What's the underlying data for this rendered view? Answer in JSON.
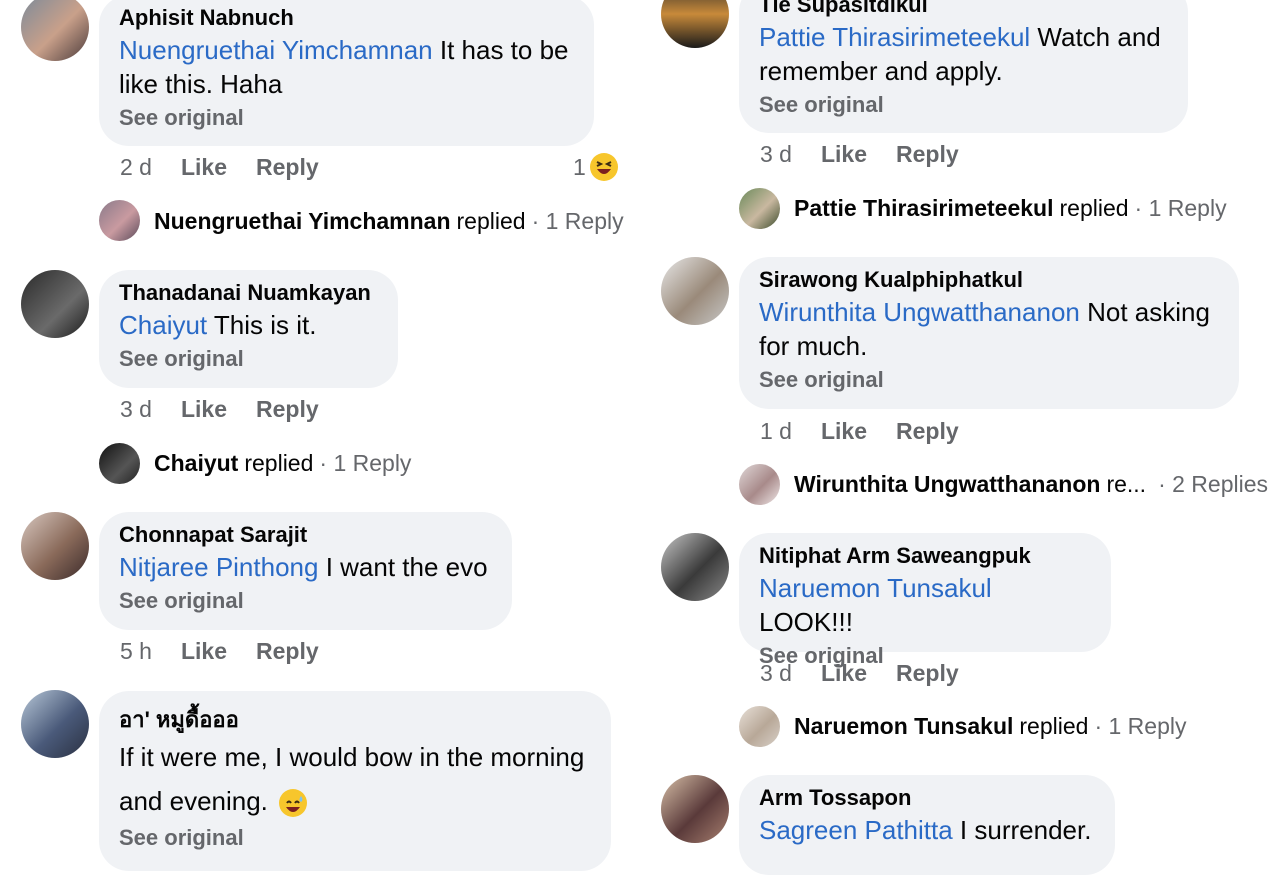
{
  "colors": {
    "bubble": "#f0f2f5",
    "mention": "#2a6ac6",
    "meta": "#65676b",
    "emoji": "#f7c62c"
  },
  "comments": [
    {
      "author": "Aphisit Nabnuch",
      "mention": "Nuengruethai Yimchamnan",
      "text_line1": " It has to be",
      "text_line2": "like this. Haha",
      "see_original": "See original",
      "time": "2 d",
      "like": "Like",
      "reply": "Reply",
      "reaction_count": "1",
      "reaction_icon": "laughing-emoji",
      "reply_author": "Nuengruethai Yimchamnan",
      "reply_verb": "replied",
      "reply_count": "· 1 Reply"
    },
    {
      "author": "Thanadanai Nuamkayan",
      "mention": "Chaiyut",
      "text_line1": " This is it.",
      "see_original": "See original",
      "time": "3 d",
      "like": "Like",
      "reply": "Reply",
      "reply_author": "Chaiyut",
      "reply_verb": "replied",
      "reply_count": "· 1 Reply"
    },
    {
      "author": "Chonnapat Sarajit",
      "mention": "Nitjaree Pinthong",
      "text_line1": " I want the evo",
      "see_original": "See original",
      "time": "5 h",
      "like": "Like",
      "reply": "Reply"
    },
    {
      "author": "อา' หมูดื้อออ",
      "text_line1": "If it were me, I would bow in the morning",
      "text_line2": "and evening.",
      "text_icon": "sweat-smile-emoji",
      "see_original": "See original"
    },
    {
      "author": "Tle Supasitdikul",
      "mention": "Pattie Thirasirimeteekul",
      "text_line1": " Watch and",
      "text_line2": "remember and apply.",
      "see_original": "See original",
      "time": "3 d",
      "like": "Like",
      "reply": "Reply",
      "reply_author": "Pattie Thirasirimeteekul",
      "reply_verb": "replied",
      "reply_count": "· 1 Reply"
    },
    {
      "author": "Sirawong Kualphiphatkul",
      "mention": "Wirunthita Ungwatthananon",
      "text_line1": " Not asking",
      "text_line2": "for much.",
      "see_original": "See original",
      "time": "1 d",
      "like": "Like",
      "reply": "Reply",
      "reply_author": "Wirunthita Ungwatthananon",
      "reply_verb": "re...",
      "reply_count": "· 2 Replies"
    },
    {
      "author": "Nitiphat Arm Saweangpuk",
      "mention": "Naruemon Tunsakul",
      "text_line1": " LOOK!!!",
      "see_original": "See original",
      "time": "3 d",
      "like": "Like",
      "reply": "Reply",
      "reply_author": "Naruemon Tunsakul",
      "reply_verb": "replied",
      "reply_count": "· 1 Reply"
    },
    {
      "author": "Arm Tossapon",
      "mention": "Sagreen Pathitta",
      "text_line1": " I surrender."
    }
  ]
}
